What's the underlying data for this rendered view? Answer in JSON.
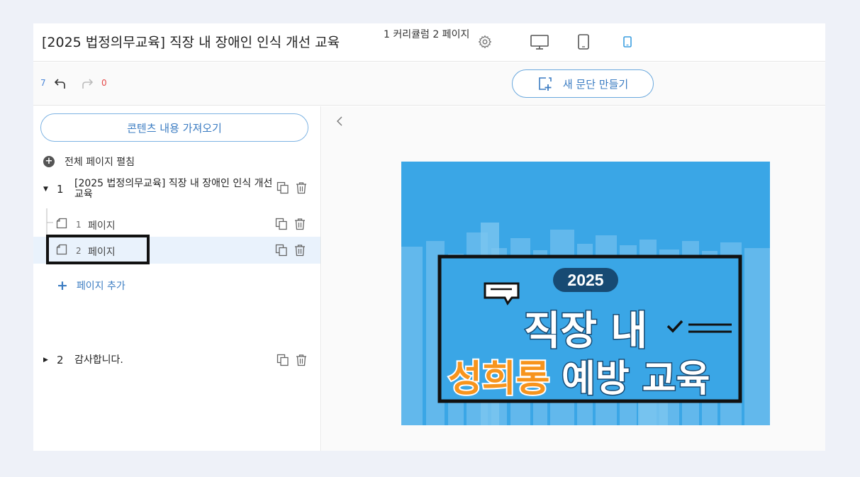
{
  "header": {
    "title": "[2025 법정의무교육] 직장 내 장애인 인식 개선 교육",
    "curriculum_info": "1 커리큘럼 2 페이지",
    "settings_icon": "gear-icon",
    "devices": [
      "desktop-icon",
      "tablet-icon",
      "mobile-icon"
    ],
    "active_device_color": "#3b9ee0"
  },
  "toolbar": {
    "undo_count": "7",
    "redo_count": "0",
    "new_paragraph_label": "새 문단 만들기"
  },
  "sidebar": {
    "import_label": "콘텐츠 내용 가져오기",
    "expand_all_label": "전체 페이지 펼침",
    "sections": [
      {
        "number": "1",
        "title": "[2025 법정의무교육] 직장 내 장애인 인식 개선 교육",
        "pages": [
          {
            "number": "1",
            "label": "페이지"
          },
          {
            "number": "2",
            "label": "페이지",
            "selected": true
          }
        ]
      },
      {
        "number": "2",
        "title": "감사합니다."
      }
    ],
    "add_page_label": "페이지 추가"
  },
  "preview": {
    "year": "2025",
    "line1": "직장 내",
    "highlight": "성희롱",
    "line2_rest": "예방 교육",
    "bg_color": "#3aa6e6",
    "highlight_color": "#f7941d"
  }
}
